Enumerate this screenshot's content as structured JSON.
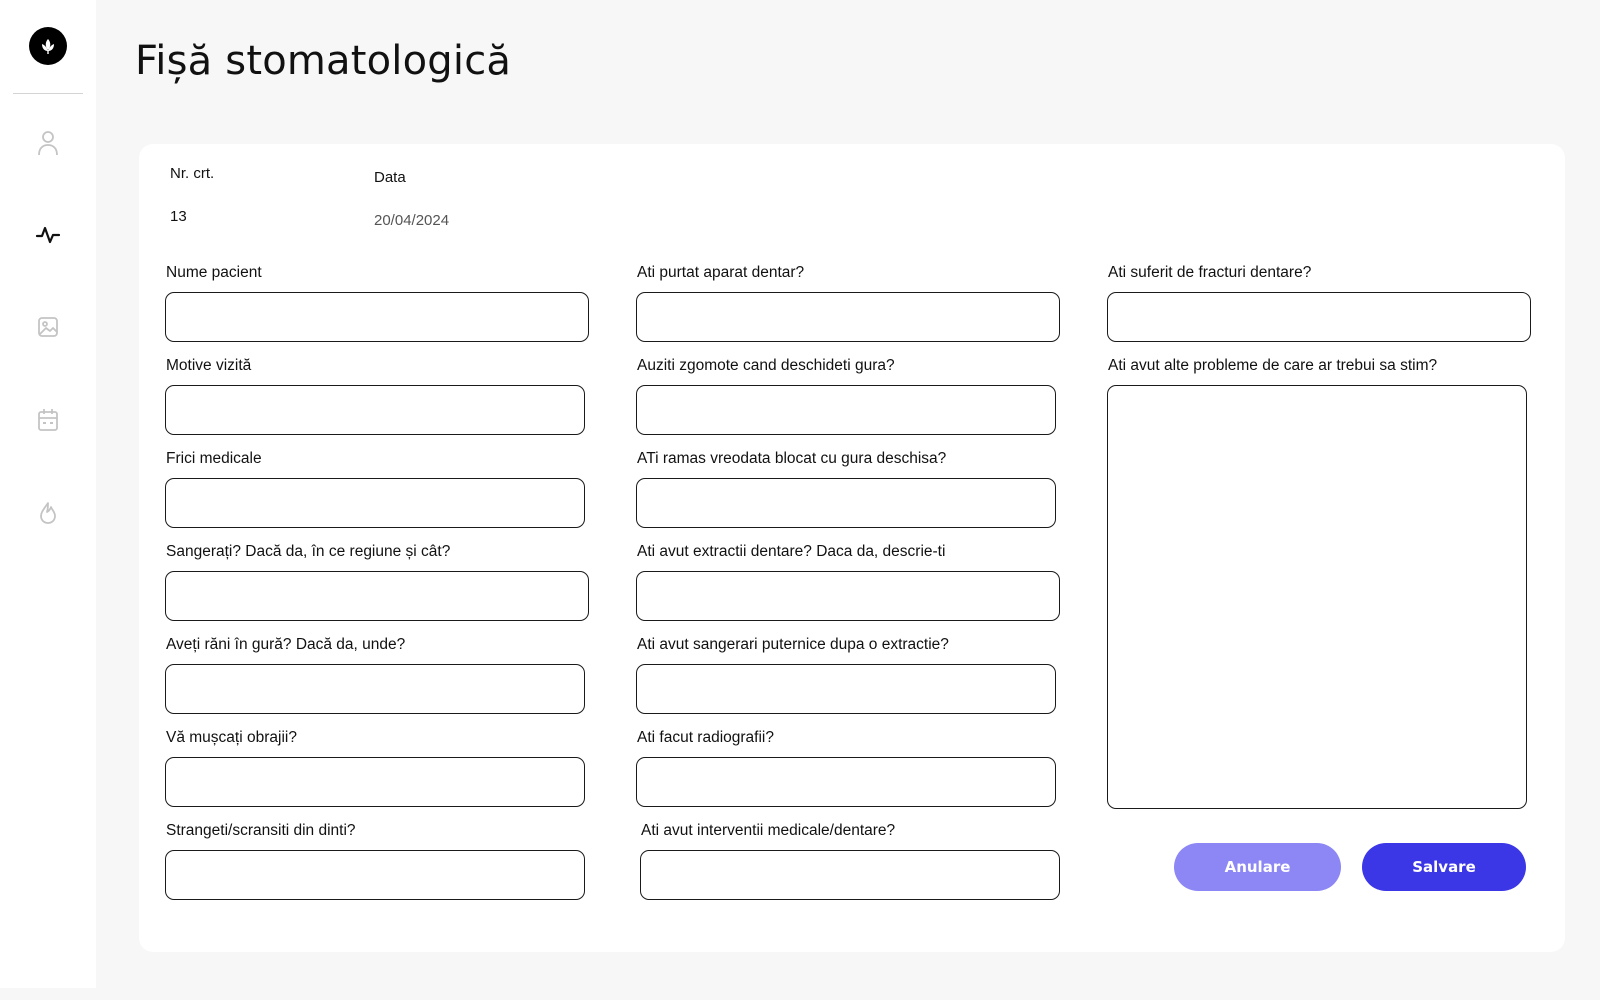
{
  "page": {
    "title": "Fișă stomatologică"
  },
  "colors": {
    "primary": "#3b36e6",
    "primary_light": "#8c87f4",
    "background": "#f7f7f7"
  },
  "sidebar": {
    "logo": "leaf-logo-icon",
    "items": [
      {
        "icon": "user-icon",
        "active": false
      },
      {
        "icon": "activity-icon",
        "active": true
      },
      {
        "icon": "image-icon",
        "active": false
      },
      {
        "icon": "calendar-icon",
        "active": false
      },
      {
        "icon": "flame-icon",
        "active": false
      }
    ]
  },
  "meta": {
    "nr_label": "Nr. crt.",
    "nr_value": "13",
    "date_label": "Data",
    "date_value": "20/04/2024"
  },
  "form": {
    "col1": [
      {
        "label": "Nume pacient",
        "value": ""
      },
      {
        "label": "Motive vizită",
        "value": ""
      },
      {
        "label": "Frici medicale",
        "value": ""
      },
      {
        "label": "Sangerați? Dacă da, în ce regiune și cât?",
        "value": ""
      },
      {
        "label": "Aveți răni în gură? Dacă da, unde?",
        "value": ""
      },
      {
        "label": "Vă mușcați obrajii?",
        "value": ""
      },
      {
        "label": "Strangeti/scransiti din dinti?",
        "value": ""
      }
    ],
    "col2": [
      {
        "label": "Ati purtat aparat dentar?",
        "value": ""
      },
      {
        "label": "Auziti zgomote cand deschideti gura?",
        "value": ""
      },
      {
        "label": "ATi ramas vreodata blocat cu gura deschisa?",
        "value": ""
      },
      {
        "label": "Ati avut extractii dentare? Daca da, descrie-ti",
        "value": ""
      },
      {
        "label": "Ati avut sangerari puternice dupa o extractie?",
        "value": ""
      },
      {
        "label": "Ati facut radiografii?",
        "value": ""
      },
      {
        "label": "Ati avut interventii medicale/dentare?",
        "value": ""
      }
    ],
    "col3": [
      {
        "label": "Ati suferit de fracturi dentare?",
        "value": ""
      },
      {
        "label": "Ati avut alte probleme de care ar trebui sa stim?",
        "value": ""
      }
    ]
  },
  "actions": {
    "cancel_label": "Anulare",
    "save_label": "Salvare"
  }
}
